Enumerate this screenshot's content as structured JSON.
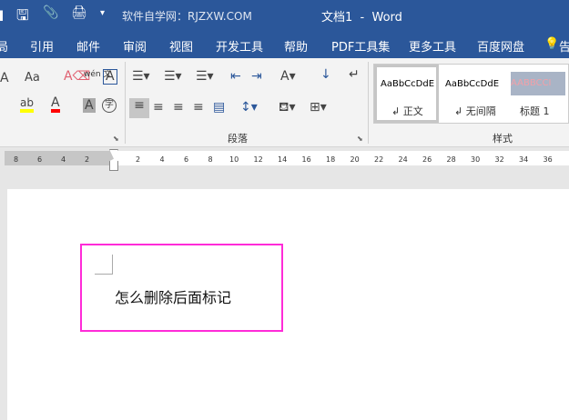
{
  "title_bar": {
    "site": "软件自学网：RJZXW.COM",
    "doc_title": "文档1  -  Word",
    "icons": [
      "save-icon",
      "attach-icon",
      "print-check-icon",
      "customize-icon"
    ]
  },
  "tabs": [
    "局",
    "引用",
    "邮件",
    "审阅",
    "视图",
    "开发工具",
    "帮助",
    "PDF工具集",
    "更多工具",
    "百度网盘",
    "告"
  ],
  "ribbon": {
    "font_group": {
      "case": "Aa",
      "phonetic": "wén 文",
      "border_char": "A",
      "enclose": "字"
    },
    "paragraph_label": "段落",
    "styles_label": "样式",
    "styles": [
      {
        "preview": "AaBbCcDdE",
        "name": "↲ 正文"
      },
      {
        "preview": "AaBbCcDdE",
        "name": "↲ 无间隔"
      },
      {
        "preview": "AABBCCI",
        "name": "标题 1"
      }
    ]
  },
  "ruler": {
    "left": [
      "8",
      "6",
      "4",
      "2"
    ],
    "right": [
      "2",
      "4",
      "6",
      "8",
      "10",
      "12",
      "14",
      "16",
      "18",
      "20",
      "22",
      "24",
      "26",
      "28",
      "30",
      "32",
      "34",
      "36"
    ]
  },
  "document": {
    "text": "怎么删除后面标记",
    "highlight_color": "#ff2bd8"
  },
  "colors": {
    "accent": "#2b579a",
    "highlight": "#ffff00",
    "font_color": "#ff0000"
  }
}
